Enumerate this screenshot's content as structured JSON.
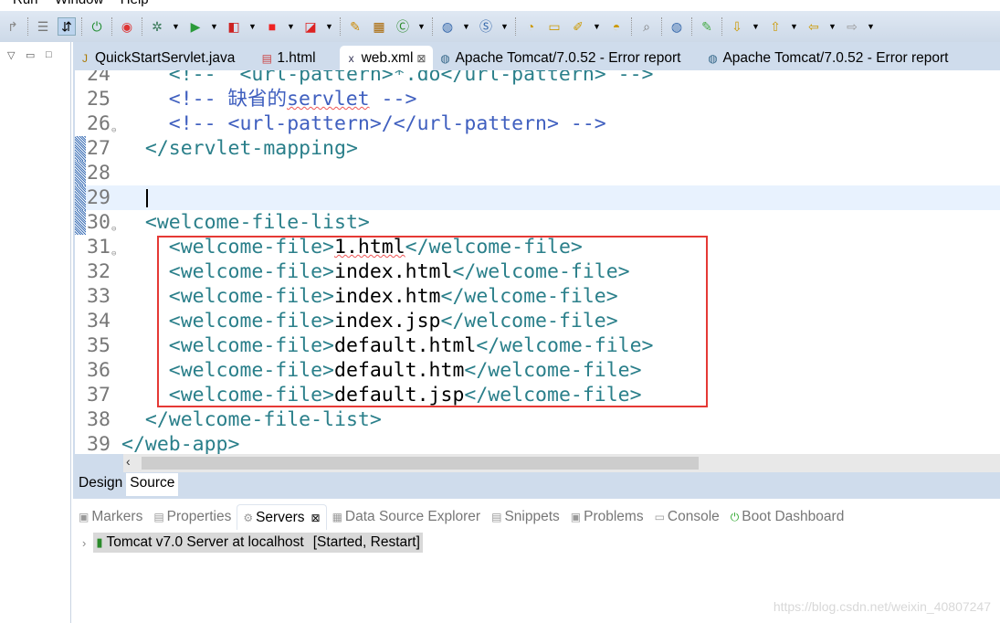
{
  "menu": [
    "Run",
    "Window",
    "Help"
  ],
  "tabs": [
    {
      "label": "QuickStartServlet.java",
      "icon": "java-file-warning-icon"
    },
    {
      "label": "1.html",
      "icon": "html-file-icon"
    },
    {
      "label": "web.xml",
      "icon": "xml-file-icon",
      "active": true,
      "close": "⊠"
    },
    {
      "label": "Apache Tomcat/7.0.52 - Error report",
      "icon": "globe-icon"
    },
    {
      "label": "Apache Tomcat/7.0.52 - Error report",
      "icon": "globe-icon"
    }
  ],
  "editor": {
    "lines": [
      {
        "n": "24",
        "segs": [
          [
            "t-tag",
            "    <!--  <url-pattern>*.do</url-pattern> -->"
          ]
        ]
      },
      {
        "n": "25",
        "segs": [
          [
            "t-cm",
            "    <!-- 缺省的"
          ],
          [
            "t-cm squig",
            "servlet"
          ],
          [
            "t-cm",
            " -->"
          ]
        ]
      },
      {
        "n": "26",
        "fold": true,
        "segs": [
          [
            "t-cm",
            "    <!-- <url-pattern>/</url-pattern> -->"
          ]
        ]
      },
      {
        "n": "27",
        "marker": true,
        "segs": [
          [
            "t-tag",
            "  </servlet-mapping>"
          ]
        ]
      },
      {
        "n": "28",
        "marker": true,
        "segs": []
      },
      {
        "n": "29",
        "marker": true,
        "current": true,
        "segs": []
      },
      {
        "n": "30",
        "marker": true,
        "fold": true,
        "segs": [
          [
            "t-tag",
            "  <welcome-file-list>"
          ]
        ]
      },
      {
        "n": "31",
        "fold": true,
        "segs": [
          [
            "t-tag",
            "    <welcome-file>"
          ],
          [
            "t-txt squig",
            "1.html"
          ],
          [
            "t-tag",
            "</welcome-file>"
          ]
        ]
      },
      {
        "n": "32",
        "segs": [
          [
            "t-tag",
            "    <welcome-file>"
          ],
          [
            "t-txt",
            "index.html"
          ],
          [
            "t-tag",
            "</welcome-file>"
          ]
        ]
      },
      {
        "n": "33",
        "segs": [
          [
            "t-tag",
            "    <welcome-file>"
          ],
          [
            "t-txt",
            "index.htm"
          ],
          [
            "t-tag",
            "</welcome-file>"
          ]
        ]
      },
      {
        "n": "34",
        "segs": [
          [
            "t-tag",
            "    <welcome-file>"
          ],
          [
            "t-txt",
            "index.jsp"
          ],
          [
            "t-tag",
            "</welcome-file>"
          ]
        ]
      },
      {
        "n": "35",
        "segs": [
          [
            "t-tag",
            "    <welcome-file>"
          ],
          [
            "t-txt",
            "default.html"
          ],
          [
            "t-tag",
            "</welcome-file>"
          ]
        ]
      },
      {
        "n": "36",
        "segs": [
          [
            "t-tag",
            "    <welcome-file>"
          ],
          [
            "t-txt",
            "default.htm"
          ],
          [
            "t-tag",
            "</welcome-file>"
          ]
        ]
      },
      {
        "n": "37",
        "segs": [
          [
            "t-tag",
            "    <welcome-file>"
          ],
          [
            "t-txt",
            "default.jsp"
          ],
          [
            "t-tag",
            "</welcome-file>"
          ]
        ]
      },
      {
        "n": "38",
        "segs": [
          [
            "t-tag",
            "  </welcome-file-list>"
          ]
        ]
      },
      {
        "n": "39",
        "segs": [
          [
            "t-tag",
            "</web-app>"
          ]
        ]
      }
    ]
  },
  "editor_tabs": {
    "design": "Design",
    "source": "Source"
  },
  "bottom_tabs": [
    {
      "label": "Markers",
      "icon": "markers-icon"
    },
    {
      "label": "Properties",
      "icon": "properties-icon"
    },
    {
      "label": "Servers",
      "icon": "servers-icon",
      "active": true,
      "close": "⊠"
    },
    {
      "label": "Data Source Explorer",
      "icon": "data-source-icon"
    },
    {
      "label": "Snippets",
      "icon": "snippets-icon"
    },
    {
      "label": "Problems",
      "icon": "problems-icon"
    },
    {
      "label": "Console",
      "icon": "console-icon"
    },
    {
      "label": "Boot Dashboard",
      "icon": "boot-dashboard-icon"
    }
  ],
  "server": {
    "name": "Tomcat v7.0 Server at localhost",
    "status": "[Started, Restart]"
  },
  "watermark": "https://blog.csdn.net/weixin_40807247",
  "colors": {
    "tag": "#2a7f8a",
    "comment": "#3f5fbf",
    "highlight_box": "#e53935",
    "current_line": "#e8f2fe"
  }
}
